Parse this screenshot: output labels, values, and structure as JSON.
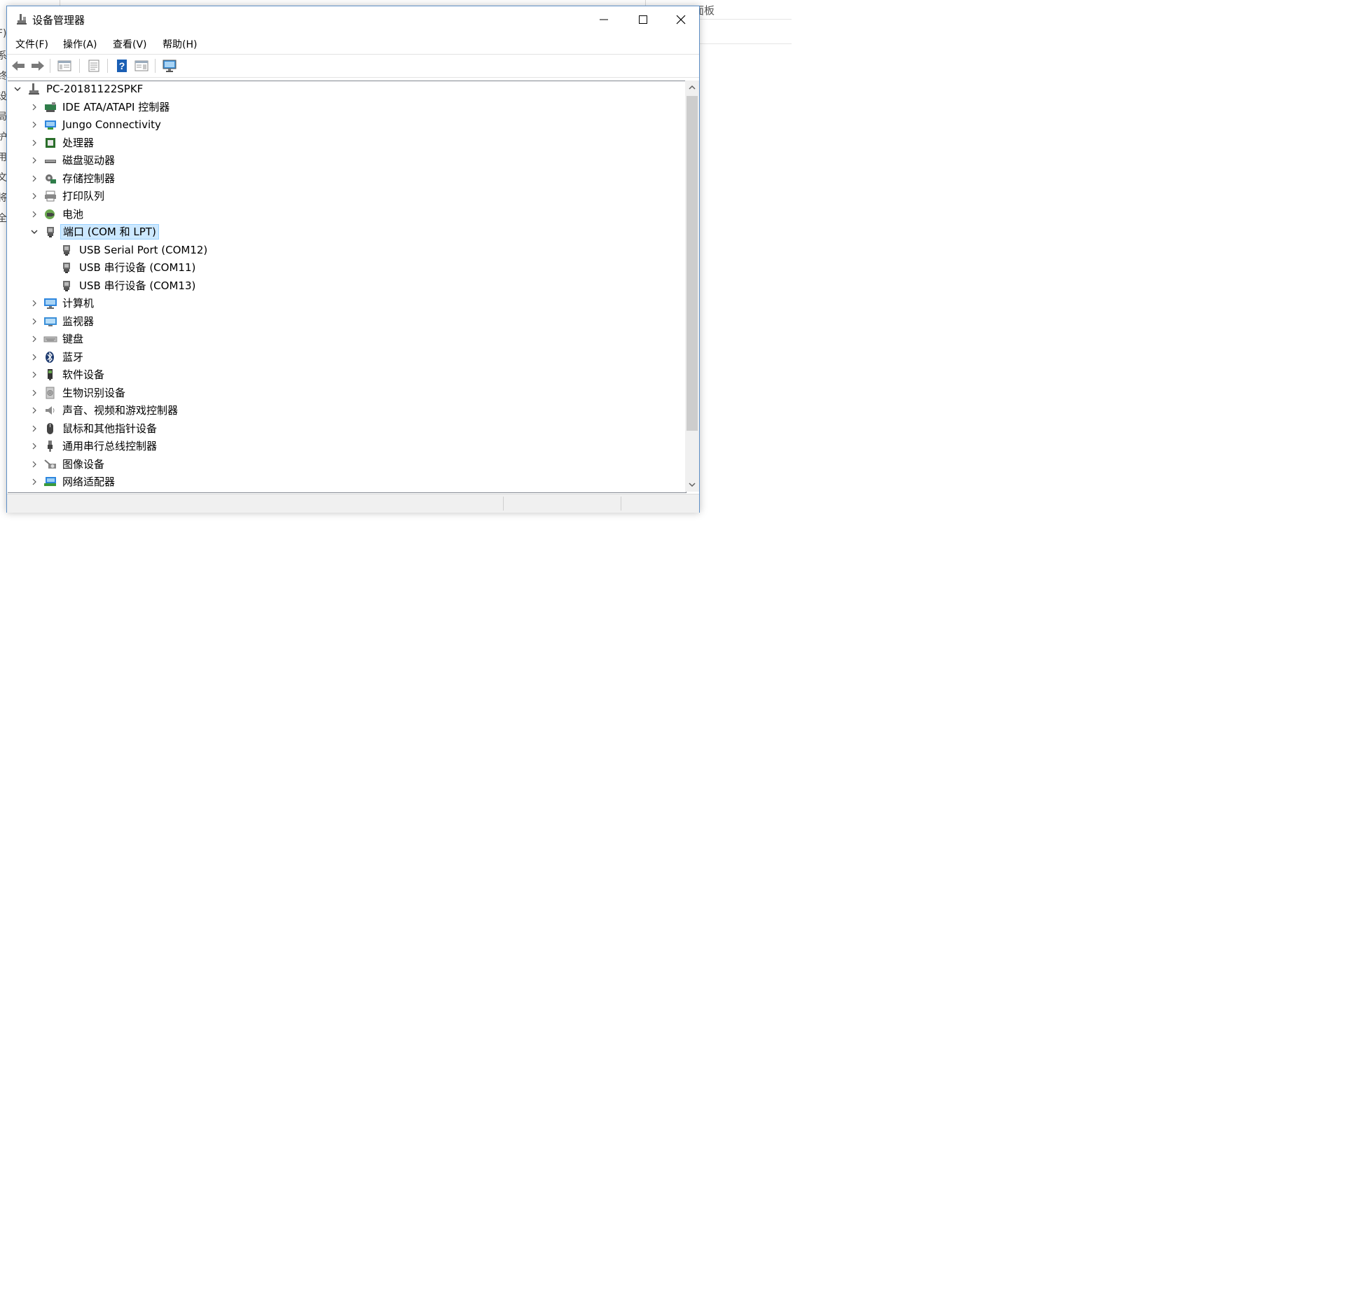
{
  "background": {
    "search_hint": "面板",
    "left_strip_chars": [
      "F)",
      "系",
      "终",
      "设",
      "局",
      "护",
      "用",
      "文",
      "将",
      "全"
    ]
  },
  "window": {
    "title": "设备管理器",
    "caption_buttons": [
      "minimize-icon",
      "maximize-icon",
      "close-icon"
    ]
  },
  "menu": {
    "file": "文件(F)",
    "action": "操作(A)",
    "view": "查看(V)",
    "help": "帮助(H)"
  },
  "toolbar": {
    "buttons": [
      "back-icon",
      "forward-icon",
      "show-hide-tree-icon",
      "properties-icon",
      "help-icon",
      "action-view-icon",
      "monitor-icon"
    ]
  },
  "tree": {
    "root": {
      "label": "PC-20181122SPKF",
      "expanded": true
    },
    "categories": [
      {
        "label": "IDE ATA/ATAPI 控制器",
        "icon": "ide-controller-icon",
        "expanded": false
      },
      {
        "label": "Jungo Connectivity",
        "icon": "jungo-icon",
        "expanded": false
      },
      {
        "label": "处理器",
        "icon": "processor-icon",
        "expanded": false
      },
      {
        "label": "磁盘驱动器",
        "icon": "disk-drive-icon",
        "expanded": false
      },
      {
        "label": "存储控制器",
        "icon": "storage-controller-icon",
        "expanded": false
      },
      {
        "label": "打印队列",
        "icon": "printer-icon",
        "expanded": false
      },
      {
        "label": "电池",
        "icon": "battery-icon",
        "expanded": false
      },
      {
        "label": "端口 (COM 和 LPT)",
        "icon": "port-icon",
        "expanded": true,
        "selected": true,
        "children": [
          {
            "label": "USB Serial Port (COM12)",
            "icon": "port-icon"
          },
          {
            "label": "USB 串行设备 (COM11)",
            "icon": "port-icon"
          },
          {
            "label": "USB 串行设备 (COM13)",
            "icon": "port-icon"
          }
        ]
      },
      {
        "label": "计算机",
        "icon": "computer-icon",
        "expanded": false
      },
      {
        "label": "监视器",
        "icon": "monitor-icon",
        "expanded": false
      },
      {
        "label": "键盘",
        "icon": "keyboard-icon",
        "expanded": false
      },
      {
        "label": "蓝牙",
        "icon": "bluetooth-icon",
        "expanded": false
      },
      {
        "label": "软件设备",
        "icon": "software-device-icon",
        "expanded": false
      },
      {
        "label": "生物识别设备",
        "icon": "biometric-icon",
        "expanded": false
      },
      {
        "label": "声音、视频和游戏控制器",
        "icon": "sound-icon",
        "expanded": false
      },
      {
        "label": "鼠标和其他指针设备",
        "icon": "mouse-icon",
        "expanded": false
      },
      {
        "label": "通用串行总线控制器",
        "icon": "usb-icon",
        "expanded": false
      },
      {
        "label": "图像设备",
        "icon": "imaging-device-icon",
        "expanded": false
      },
      {
        "label": "网络适配器",
        "icon": "network-adapter-icon",
        "expanded": false
      }
    ]
  },
  "colors": {
    "selection_bg": "#cce8ff",
    "window_border": "#5e8fc6",
    "help_blue": "#1a5fb4"
  }
}
